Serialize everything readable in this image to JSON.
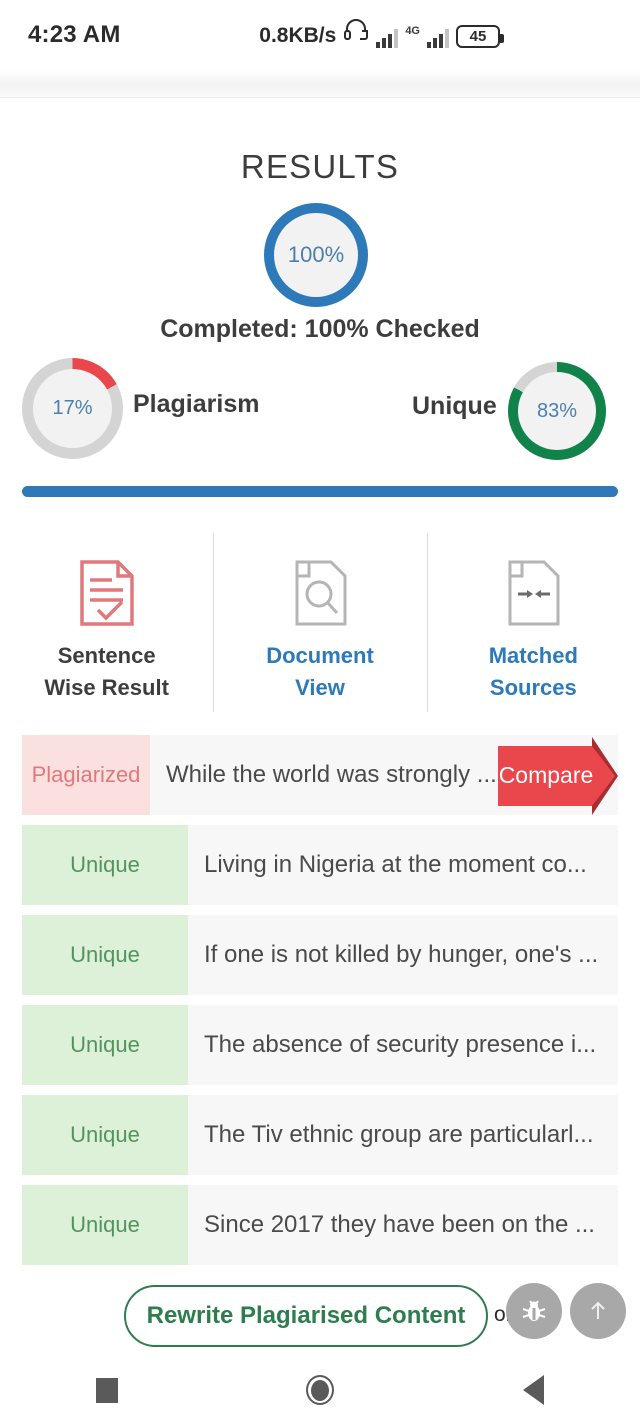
{
  "status_bar": {
    "time": "4:23 AM",
    "network_speed": "0.8KB/s",
    "headphone_icon": "headphone-icon",
    "signal_label": "4G",
    "battery_level": "45"
  },
  "header": {
    "title": "RESULTS",
    "main_percent": "100%",
    "completed_text": "Completed: 100% Checked",
    "progress_percent": 100
  },
  "summary": {
    "plagiarism": {
      "value": "17%",
      "label": "Plagiarism",
      "percent": 17,
      "color": "#e9474b"
    },
    "unique": {
      "value": "83%",
      "label": "Unique",
      "percent": 83,
      "color": "#10824a"
    },
    "track_color": "#d4d4d4",
    "main_color": "#2e7ab8"
  },
  "tabs": [
    {
      "line1": "Sentence",
      "line2": "Wise Result",
      "icon": "document-check-icon",
      "active": true
    },
    {
      "line1": "Document",
      "line2": "View",
      "icon": "document-search-icon",
      "active": false
    },
    {
      "line1": "Matched",
      "line2": "Sources",
      "icon": "document-match-icon",
      "active": false
    }
  ],
  "results": [
    {
      "status": "Plagiarized",
      "type": "plag",
      "sentence": "While the world was strongly ...",
      "action": "Compare"
    },
    {
      "status": "Unique",
      "type": "uniq",
      "sentence": "Living in Nigeria at the moment co..."
    },
    {
      "status": "Unique",
      "type": "uniq",
      "sentence": "If one is not killed by hunger, one's ..."
    },
    {
      "status": "Unique",
      "type": "uniq",
      "sentence": "The absence of security presence i..."
    },
    {
      "status": "Unique",
      "type": "uniq",
      "sentence": "The Tiv ethnic group are particularl..."
    },
    {
      "status": "Unique",
      "type": "uniq",
      "sentence": "Since 2017 they have been on the ..."
    }
  ],
  "bottom": {
    "rewrite_label": "Rewrite Plagiarised Content",
    "or_label": "or",
    "bug_icon": "bug-icon",
    "scroll_top_icon": "arrow-up-icon"
  },
  "navbar": {
    "recents_icon": "square-recents-icon",
    "home_icon": "circle-home-icon",
    "back_icon": "triangle-back-icon"
  }
}
